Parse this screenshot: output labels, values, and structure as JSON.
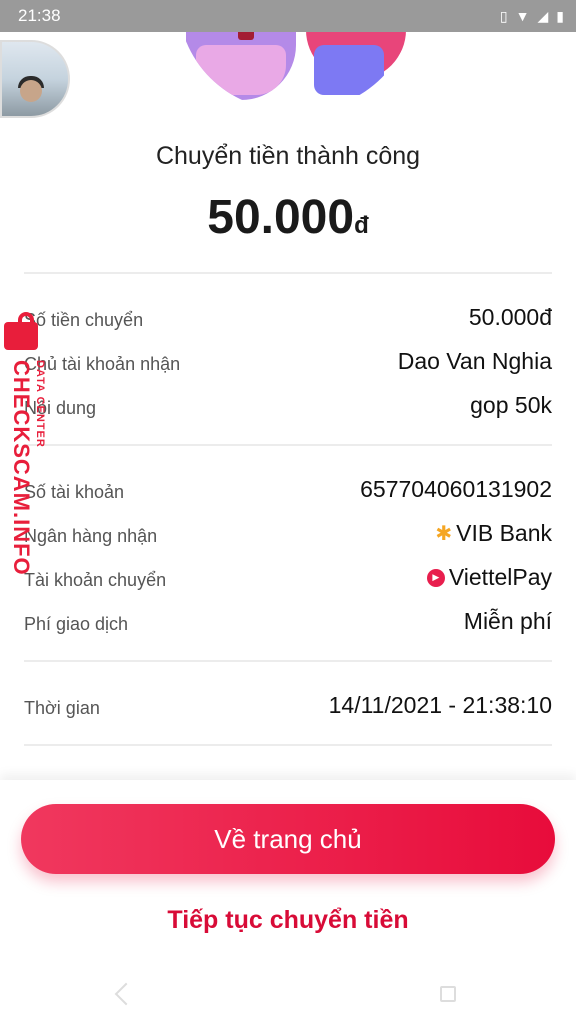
{
  "status_bar": {
    "time": "21:38"
  },
  "header": {
    "title": "Chuyển tiền thành công",
    "amount": "50.000",
    "currency": "đ"
  },
  "details": {
    "group1": [
      {
        "label": "Số tiền chuyển",
        "value": "50.000đ"
      },
      {
        "label": "Chủ tài khoản nhận",
        "value": "Dao Van Nghia"
      },
      {
        "label": "Nội dung",
        "value": "gop 50k"
      }
    ],
    "group2": [
      {
        "label": "Số tài khoản",
        "value": "657704060131902"
      },
      {
        "label": "Ngân hàng nhận",
        "value": "VIB Bank",
        "icon": "vib-star-icon"
      },
      {
        "label": "Tài khoản chuyển",
        "value": "ViettelPay",
        "icon": "viettelpay-icon"
      },
      {
        "label": "Phí giao dịch",
        "value": "Miễn phí"
      }
    ],
    "group3": [
      {
        "label": "Thời gian",
        "value": "14/11/2021 - 21:38:10"
      }
    ]
  },
  "actions": {
    "home_label": "Về trang chủ",
    "continue_label": "Tiếp tục chuyển tiền"
  },
  "watermark": {
    "main": "CHECKSCAM.INFO",
    "sub": "DATA CENTER"
  },
  "colors": {
    "accent": "#e80c3b",
    "watermark": "#e81e3b"
  }
}
